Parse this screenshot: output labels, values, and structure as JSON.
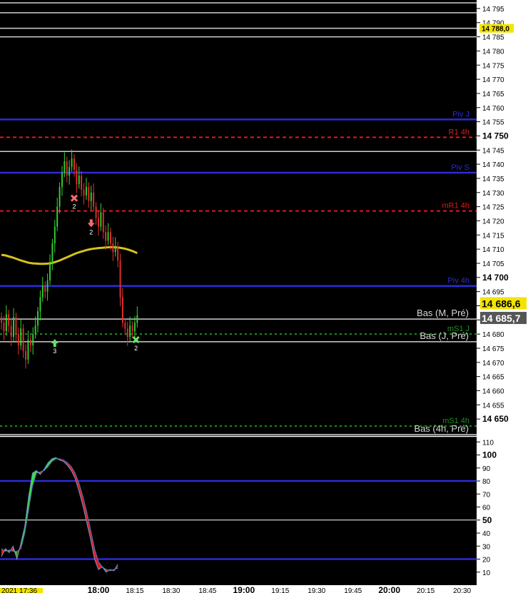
{
  "colors": {
    "background": "#000000",
    "axis_panel": "#ffffff",
    "up": "#33d633",
    "down": "#e83030",
    "ma": "#d6c21a",
    "pivot": "#2b2bd8",
    "resistance": "#e01b1b",
    "support": "#1f8f1f",
    "reference": "#cfcfcf",
    "osc_band": "#2b2bd8",
    "osc_up": "#33e633",
    "osc_down": "#e81a1a"
  },
  "price_axis": {
    "ylim": [
      14644,
      14798
    ],
    "ticks": [
      14795,
      14790,
      14785,
      14780,
      14775,
      14770,
      14765,
      14760,
      14755,
      14750,
      14745,
      14740,
      14735,
      14730,
      14725,
      14720,
      14715,
      14710,
      14705,
      14700,
      14695,
      14690,
      14685,
      14680,
      14675,
      14670,
      14665,
      14660,
      14655,
      14650
    ],
    "tick_labels": [
      "14 795",
      "14 790",
      "14 785",
      "14 780",
      "14 775",
      "14 770",
      "14 765",
      "14 760",
      "14 755",
      "14 750",
      "14 745",
      "14 740",
      "14 735",
      "14 730",
      "14 725",
      "14 720",
      "14 715",
      "14 710",
      "14 705",
      "14 700",
      "14 695",
      "14 690",
      "14 685",
      "14 680",
      "14 675",
      "14 670",
      "14 665",
      "14 660",
      "14 655",
      "14 650"
    ],
    "bold_ticks": [
      14750,
      14700,
      14650
    ]
  },
  "price_tags": [
    {
      "label": "14 788,0",
      "value": 14788.0,
      "bg": "#f2e400",
      "fg": "#000000",
      "size": "small"
    },
    {
      "label": "14 686,6",
      "value": 14686.6,
      "bg": "#f2e400",
      "fg": "#000000",
      "size": "large"
    },
    {
      "label": "14 685,7",
      "value": 14685.7,
      "bg": "#555555",
      "fg": "#ffffff",
      "size": "large"
    }
  ],
  "levels": [
    {
      "value": 14797,
      "label": "",
      "style": "solid",
      "color": "#cfcfcf"
    },
    {
      "value": 14793.5,
      "label": "",
      "style": "solid",
      "color": "#cfcfcf"
    },
    {
      "value": 14788,
      "label": "",
      "style": "solid",
      "color": "#cfcfcf"
    },
    {
      "value": 14785,
      "label": "",
      "style": "solid",
      "color": "#cfcfcf"
    },
    {
      "value": 14755.8,
      "label": "Piv J",
      "style": "solid",
      "color": "#2b2bd8"
    },
    {
      "value": 14749.5,
      "label": "R1 4h",
      "style": "dashed",
      "color": "#e01b1b"
    },
    {
      "value": 14744.5,
      "label": "",
      "style": "solid",
      "color": "#cfcfcf"
    },
    {
      "value": 14737.0,
      "label": "Piv S",
      "style": "solid",
      "color": "#2b2bd8"
    },
    {
      "value": 14723.5,
      "label": "mR1 4h",
      "style": "dashed",
      "color": "#e01b1b"
    },
    {
      "value": 14697.0,
      "label": "Piv 4h",
      "style": "solid",
      "color": "#2b2bd8"
    },
    {
      "value": 14685.3,
      "label": "Bas (M, Pré)",
      "style": "solid",
      "color": "#cfcfcf"
    },
    {
      "value": 14680.0,
      "label": "mS1 J",
      "style": "dashed",
      "color": "#1f8f1f"
    },
    {
      "value": 14677.3,
      "label": "Bas (J, Pré)",
      "style": "solid",
      "color": "#cfcfcf"
    },
    {
      "value": 14647.5,
      "label": "mS1 4h",
      "style": "dashed",
      "color": "#1f8f1f"
    },
    {
      "value": 14644.5,
      "label": "Bas (4h, Pré)",
      "style": "solid",
      "color": "#cfcfcf"
    }
  ],
  "osc_axis": {
    "ylim": [
      0,
      114
    ],
    "ticks": [
      110,
      100,
      90,
      80,
      70,
      60,
      50,
      40,
      30,
      20,
      10
    ],
    "tick_labels": [
      "110",
      "100",
      "90",
      "80",
      "70",
      "60",
      "50",
      "40",
      "30",
      "20",
      "10"
    ],
    "bold_ticks": [
      100,
      50
    ],
    "bands": [
      80,
      20
    ],
    "midline": 50
  },
  "time_axis": {
    "labels": [
      {
        "text": "2021 17:36",
        "x_min": -4,
        "highlight": true
      },
      {
        "text": "18:00",
        "x_min": 20,
        "bold": true
      },
      {
        "text": "18:15",
        "x_min": 35
      },
      {
        "text": "18:30",
        "x_min": 50
      },
      {
        "text": "18:45",
        "x_min": 65
      },
      {
        "text": "19:00",
        "x_min": 80,
        "bold": true
      },
      {
        "text": "19:15",
        "x_min": 95
      },
      {
        "text": "19:30",
        "x_min": 110
      },
      {
        "text": "19:45",
        "x_min": 125
      },
      {
        "text": "20:00",
        "x_min": 140,
        "bold": true
      },
      {
        "text": "20:15",
        "x_min": 155
      },
      {
        "text": "20:30",
        "x_min": 170
      }
    ],
    "min_range": [
      -20.6,
      176
    ]
  },
  "chart_data": {
    "type": "candlestick",
    "start_minute": -20,
    "interval_minutes": 1,
    "closes": [
      14684,
      14681,
      14687,
      14683,
      14679,
      14686,
      14680,
      14676,
      14682,
      14674,
      14671,
      14678,
      14676,
      14680,
      14683,
      14688,
      14693,
      14697,
      14695,
      14699,
      14705,
      14712,
      14718,
      14725,
      14732,
      14737,
      14741,
      14736,
      14739,
      14742,
      14738,
      14733,
      14736,
      14731,
      14729,
      14732,
      14727,
      14730,
      14725,
      14721,
      14718,
      14723,
      14716,
      14713,
      14716,
      14712,
      14709,
      14711,
      14706,
      14693,
      14684,
      14682,
      14679,
      14683,
      14681,
      14684,
      14686.6
    ],
    "ma": [
      14708,
      14707.8,
      14707.4,
      14707,
      14706.5,
      14706,
      14705.6,
      14705.2,
      14705,
      14704.9,
      14704.8,
      14704.8,
      14704.9,
      14705.1,
      14705.5,
      14706,
      14706.6,
      14707.2,
      14707.8,
      14708.4,
      14708.9,
      14709.3,
      14709.7,
      14710,
      14710.2,
      14710.4,
      14710.5,
      14710.6,
      14710.7,
      14710.7,
      14710.6,
      14710.4,
      14710.1,
      14709.7,
      14709.2,
      14708.6
    ],
    "ma_start_minute": -20,
    "ma_step_minutes": 1.6,
    "signals": [
      {
        "minute": 2,
        "price": 14677,
        "label": "3",
        "kind": "buy-arrow"
      },
      {
        "minute": 10,
        "price": 14728,
        "label": "2",
        "kind": "sell-cross"
      },
      {
        "minute": 17,
        "price": 14719,
        "label": "2",
        "kind": "sell-arrow"
      },
      {
        "minute": 35.5,
        "price": 14678,
        "label": "2",
        "kind": "buy-cross"
      }
    ],
    "oscillator": {
      "fast": [
        22,
        28,
        25,
        30,
        20,
        32,
        45,
        68,
        86,
        88,
        85,
        89,
        94,
        97,
        98,
        96,
        95,
        92,
        88,
        82,
        72,
        61,
        48,
        35,
        20,
        12,
        14,
        10,
        12,
        11,
        16
      ],
      "slow": [
        28,
        26,
        27,
        26,
        26,
        28,
        40,
        58,
        76,
        86,
        87,
        88,
        91,
        95,
        97,
        97,
        96,
        94,
        91,
        86,
        78,
        68,
        56,
        42,
        28,
        18,
        14,
        12,
        11,
        12,
        13
      ]
    },
    "osc_start_minute": -20,
    "osc_step_minutes": 1.6
  }
}
